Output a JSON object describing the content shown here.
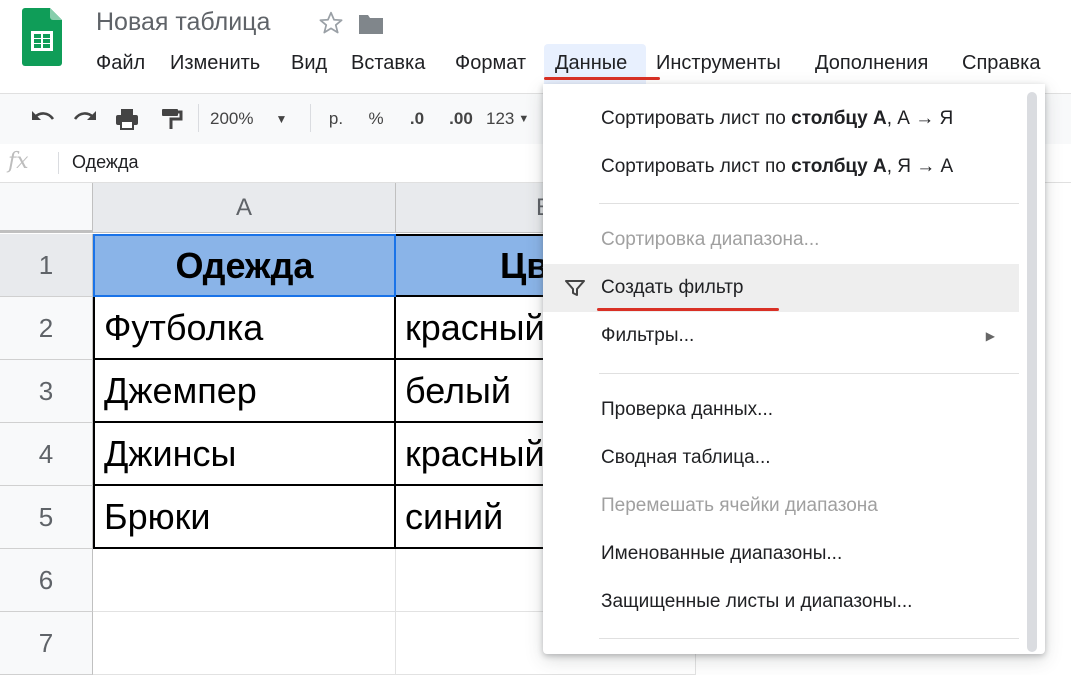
{
  "app": {
    "title": "Новая таблица",
    "menu": [
      "Файл",
      "Изменить",
      "Вид",
      "Вставка",
      "Формат",
      "Данные",
      "Инструменты",
      "Дополнения",
      "Справка"
    ],
    "active_menu": "Данные",
    "colors": {
      "accent_red": "#d93025",
      "header_fill": "#8ab4e8",
      "logo_green": "#0f9d58"
    }
  },
  "toolbar": {
    "zoom": "200%",
    "currency": "р.",
    "percent": "%",
    "dec_decrease": ".0",
    "dec_increase": ".00",
    "format_more": "123"
  },
  "formula_bar": {
    "fx": "fx",
    "value": "Одежда"
  },
  "grid": {
    "columns": [
      "A",
      "B"
    ],
    "rows": [
      "1",
      "2",
      "3",
      "4",
      "5",
      "6",
      "7"
    ],
    "cells": [
      [
        "Одежда",
        "Цвет"
      ],
      [
        "Футболка",
        "красный"
      ],
      [
        "Джемпер",
        "белый"
      ],
      [
        "Джинсы",
        "красный"
      ],
      [
        "Брюки",
        "синий"
      ]
    ]
  },
  "dropdown": {
    "sort_asc": {
      "prefix": "Сортировать лист по ",
      "bold": "столбцу А",
      "suffix": ", А → Я"
    },
    "sort_desc": {
      "prefix": "Сортировать лист по ",
      "bold": "столбцу А",
      "suffix": ", Я → А"
    },
    "sort_range": "Сортировка диапазона...",
    "create_filter": "Создать фильтр",
    "filters": "Фильтры...",
    "data_validation": "Проверка данных...",
    "pivot_table": "Сводная таблица...",
    "randomize_range": "Перемешать ячейки диапазона",
    "named_ranges": "Именованные диапазоны...",
    "protected_sheets": "Защищенные листы и диапазоны..."
  }
}
